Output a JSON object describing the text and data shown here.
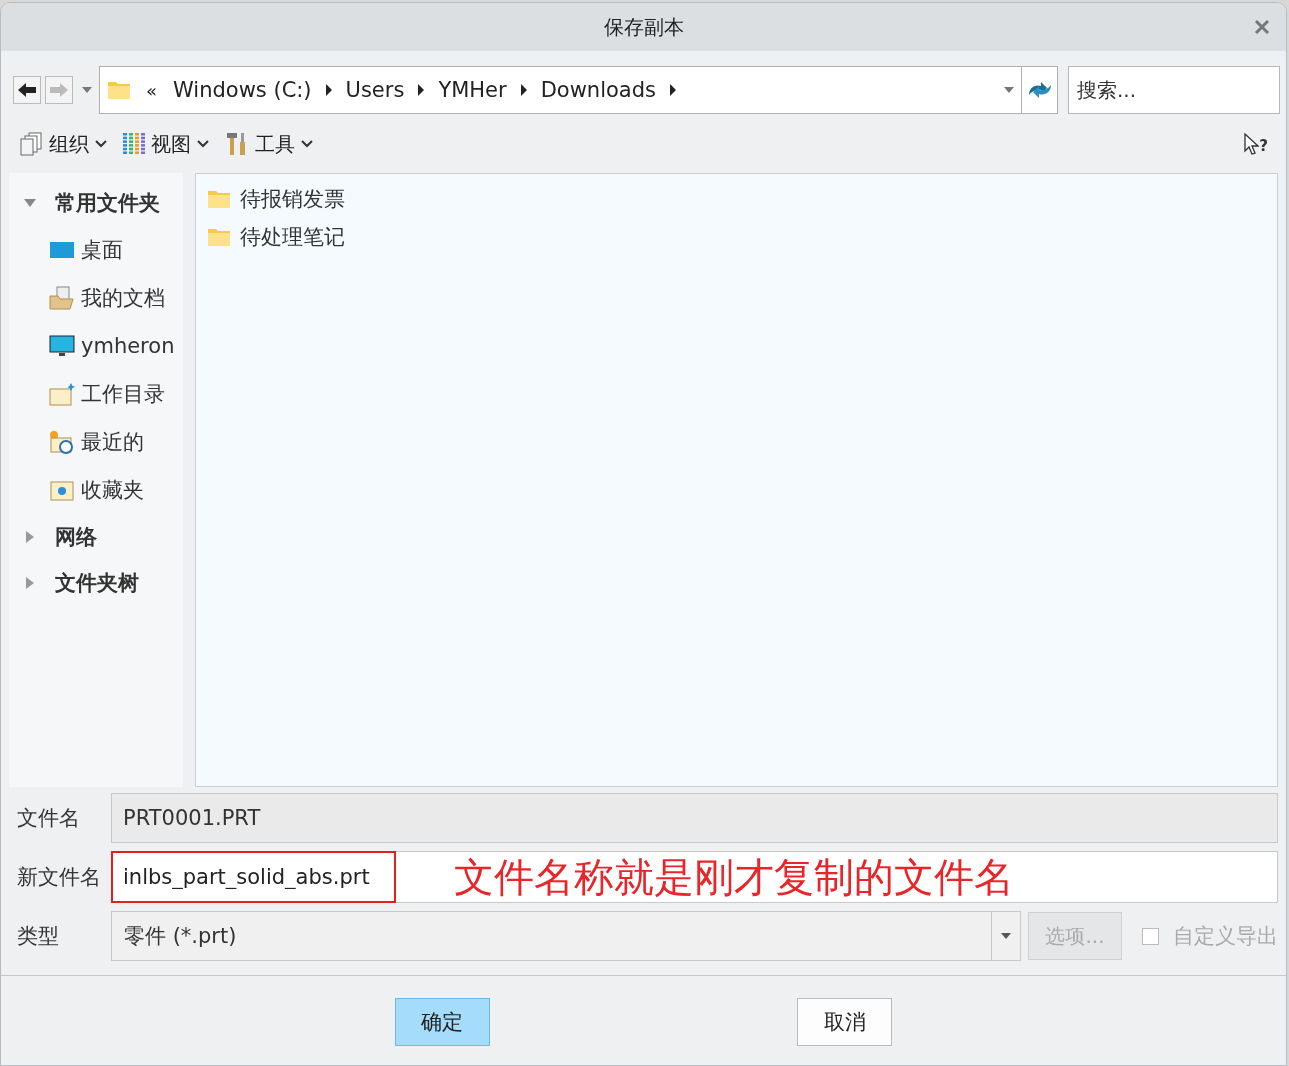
{
  "window": {
    "title": "保存副本"
  },
  "address_bar": {
    "overflow": "«",
    "crumbs": [
      "Windows (C:)",
      "Users",
      "YMHer",
      "Downloads"
    ]
  },
  "search": {
    "placeholder": "搜索..."
  },
  "help": {
    "glyph": "?"
  },
  "toolbar": [
    {
      "label": "组织",
      "kind": "organize"
    },
    {
      "label": "视图",
      "kind": "view"
    },
    {
      "label": "工具",
      "kind": "tools"
    }
  ],
  "sidebar": [
    {
      "label": "常用文件夹",
      "expanded": true,
      "children": [
        {
          "label": "桌面",
          "kind": "desktop"
        },
        {
          "label": "我的文档",
          "kind": "documents"
        },
        {
          "label": "ymheron",
          "kind": "computer"
        },
        {
          "label": "工作目录",
          "kind": "workdir"
        },
        {
          "label": "最近的",
          "kind": "recent"
        },
        {
          "label": "收藏夹",
          "kind": "favorites"
        }
      ]
    },
    {
      "label": "网络",
      "expanded": false
    },
    {
      "label": "文件夹树",
      "expanded": false
    }
  ],
  "files": [
    {
      "name": "待报销发票"
    },
    {
      "name": "待处理笔记"
    }
  ],
  "form": {
    "file_name": {
      "label": "文件名",
      "value": "PRT0001.PRT"
    },
    "new_file_name": {
      "label": "新文件名",
      "value": "inlbs_part_solid_abs.prt",
      "highlighted": true
    },
    "annotation": "文件名称就是刚才复制的文件名",
    "type": {
      "label": "类型",
      "value": "零件 (*.prt)"
    },
    "options_button": {
      "label": "选项...",
      "disabled": true
    },
    "custom_export": {
      "label": "自定义导出",
      "checked": false,
      "disabled": true
    }
  },
  "buttons": [
    {
      "label": "确定",
      "primary": true
    },
    {
      "label": "取消",
      "primary": false
    }
  ]
}
